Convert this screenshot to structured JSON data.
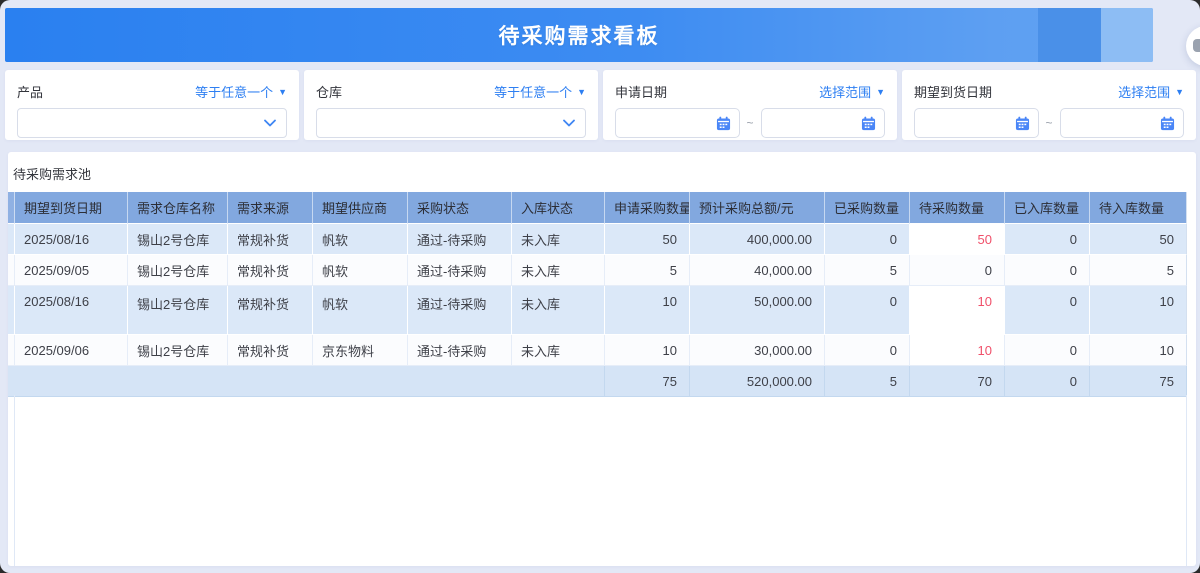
{
  "banner": {
    "title": "待采购需求看板"
  },
  "filters": [
    {
      "label": "产品",
      "op": "等于任意一个",
      "type": "select"
    },
    {
      "label": "仓库",
      "op": "等于任意一个",
      "type": "select"
    },
    {
      "label": "申请日期",
      "op": "选择范围",
      "type": "daterange",
      "separator": "~",
      "start_value": "",
      "end_value": ""
    },
    {
      "label": "期望到货日期",
      "op": "选择范围",
      "type": "daterange",
      "separator": "~",
      "start_value": "",
      "end_value": ""
    }
  ],
  "panel": {
    "title": "待采购需求池"
  },
  "table": {
    "columns": [
      "期望到货日期",
      "需求仓库名称",
      "需求来源",
      "期望供应商",
      "采购状态",
      "入库状态",
      "申请采购数量",
      "预计采购总额/元",
      "已采购数量",
      "待采购数量",
      "已入库数量",
      "待入库数量"
    ],
    "rows": [
      {
        "cells": [
          "2025/08/16",
          "锡山2号仓库",
          "常规补货",
          "帆软",
          "通过-待采购",
          "未入库",
          "50",
          "400,000.00",
          "0",
          "50",
          "0",
          "50"
        ]
      },
      {
        "cells": [
          "2025/09/05",
          "锡山2号仓库",
          "常规补货",
          "帆软",
          "通过-待采购",
          "未入库",
          "5",
          "40,000.00",
          "5",
          "0",
          "0",
          "5"
        ]
      },
      {
        "cells": [
          "2025/08/16",
          "锡山2号仓库",
          "常规补货",
          "帆软",
          "通过-待采购",
          "未入库",
          "10",
          "50,000.00",
          "0",
          "10",
          "0",
          "10"
        ]
      },
      {
        "cells": [
          "2025/09/06",
          "锡山2号仓库",
          "常规补货",
          "京东物料",
          "通过-待采购",
          "未入库",
          "10",
          "30,000.00",
          "0",
          "10",
          "0",
          "10"
        ]
      }
    ],
    "summary": [
      "75",
      "520,000.00",
      "5",
      "70",
      "0",
      "75"
    ]
  },
  "colors": {
    "banner_blue": "#2a80f0",
    "accent_blue": "#2e7ff2",
    "table_header_bg": "#82a8df",
    "zebra_blue": "#dbe8f8",
    "summary_bg": "#d5e4f6",
    "alert_red": "#f0506a"
  }
}
